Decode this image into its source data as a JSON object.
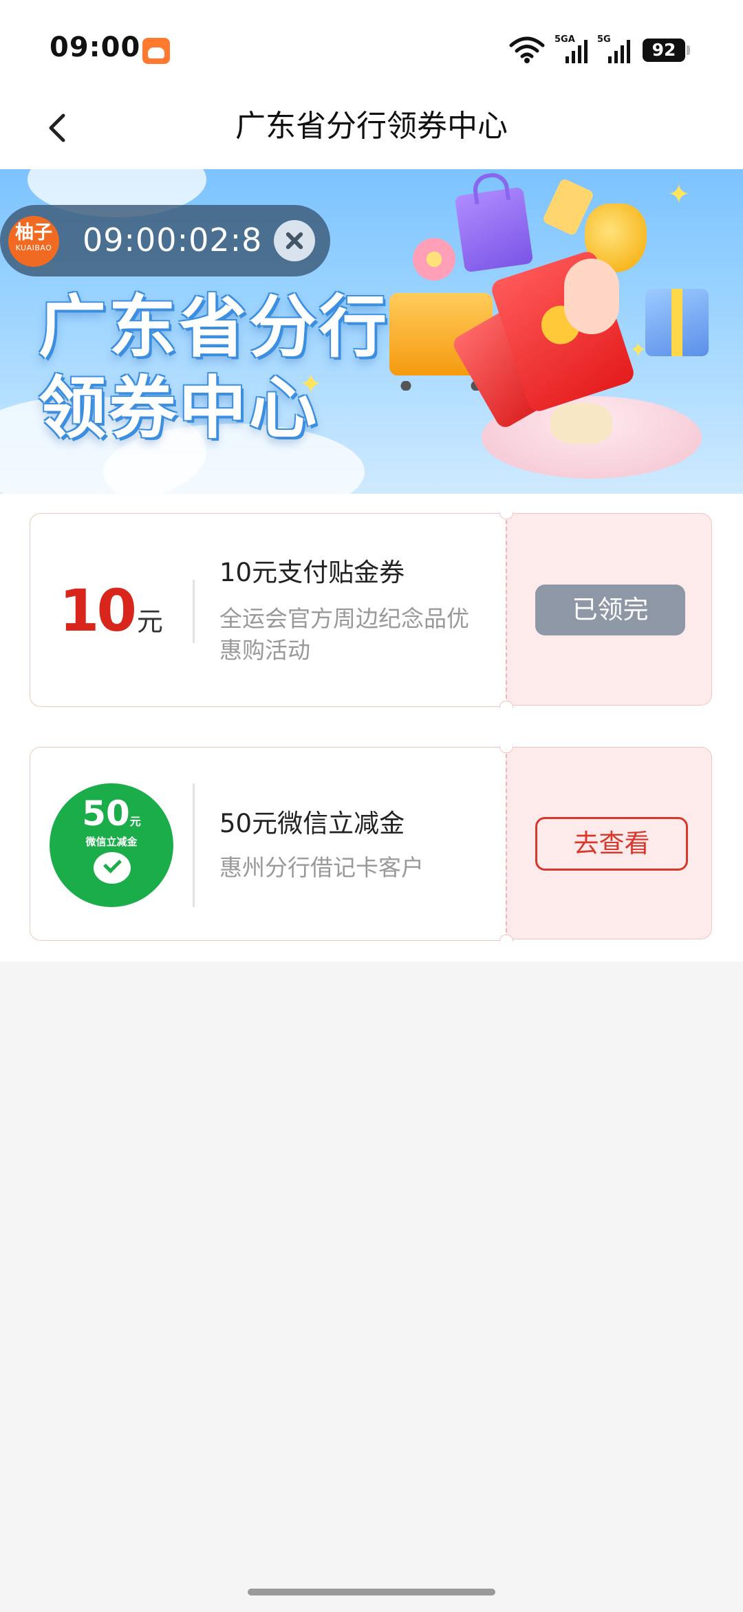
{
  "status_bar": {
    "time": "09:00",
    "network_1": "5GA",
    "network_2": "5G",
    "battery": "92"
  },
  "header": {
    "title": "广东省分行领券中心"
  },
  "banner": {
    "title_line_1": "广东省分行",
    "title_line_2": "领券中心"
  },
  "timer_widget": {
    "logo_text": "柚子",
    "logo_subtext": "KUAIBAO",
    "time": "09:00:02:8"
  },
  "coupons": [
    {
      "amount": "10",
      "unit": "元",
      "title": "10元支付贴金券",
      "description": "全运会官方周边纪念品优惠购活动",
      "button": "已领完"
    },
    {
      "badge_amount": "50",
      "badge_unit": "元",
      "badge_label": "微信立减金",
      "title": "50元微信立减金",
      "description": "惠州分行借记卡客户",
      "button": "去查看"
    }
  ],
  "colors": {
    "accent_red": "#d9261c",
    "wechat_green": "#1aad4a",
    "claimed_gray": "#8e97a5"
  }
}
